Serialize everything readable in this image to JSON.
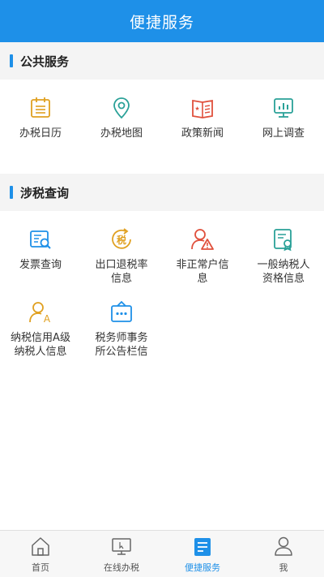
{
  "header": {
    "title": "便捷服务"
  },
  "sections": {
    "public": {
      "title": "公共服务",
      "items": [
        {
          "label": "办税日历",
          "icon": "calendar-icon",
          "color": "#e0a020"
        },
        {
          "label": "办税地图",
          "icon": "map-pin-icon",
          "color": "#2aa198"
        },
        {
          "label": "政策新闻",
          "icon": "book-icon",
          "color": "#e0503c"
        },
        {
          "label": "网上调查",
          "icon": "survey-icon",
          "color": "#2aa198"
        }
      ]
    },
    "tax": {
      "title": "涉税查询",
      "items": [
        {
          "label": "发票查询",
          "icon": "invoice-search-icon",
          "color": "#1e90e8"
        },
        {
          "label": "出口退税率信息",
          "icon": "tax-refund-icon",
          "color": "#e0a020",
          "glyph": "税"
        },
        {
          "label": "非正常户信息",
          "icon": "user-warning-icon",
          "color": "#e0503c"
        },
        {
          "label": "一般纳税人资格信息",
          "icon": "certificate-icon",
          "color": "#2aa198"
        },
        {
          "label": "纳税信用A级纳税人信息",
          "icon": "user-a-icon",
          "color": "#e0a020",
          "glyph": "A"
        },
        {
          "label": "税务师事务所公告栏信",
          "icon": "notice-board-icon",
          "color": "#1e90e8"
        }
      ]
    }
  },
  "tabbar": {
    "items": [
      {
        "label": "首页",
        "icon": "home-icon"
      },
      {
        "label": "在线办税",
        "icon": "monitor-icon"
      },
      {
        "label": "便捷服务",
        "icon": "service-doc-icon",
        "active": true
      },
      {
        "label": "我",
        "icon": "user-icon"
      }
    ]
  },
  "colors": {
    "accent": "#1e90e8",
    "section_bg": "#f4f4f4"
  }
}
